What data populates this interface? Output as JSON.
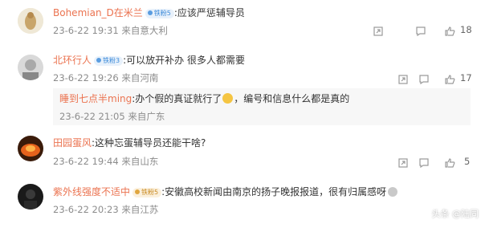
{
  "comments": [
    {
      "username": "Bohemian_D在米兰",
      "fan_badge": "铁粉5",
      "text": ":应该严惩辅导员",
      "time": "23-6-22 19:31",
      "location": "来自意大利",
      "likes": "18"
    },
    {
      "username": "北环行人",
      "fan_badge": "铁粉3",
      "text": ":可以放开补办  很多人都需要",
      "time": "23-6-22 19:26",
      "location": "来自河南",
      "likes": "17"
    },
    {
      "username": "睡到七点半ming",
      "text": ":办个假的真证就行了",
      "text2": "，编号和信息什么都是真的",
      "time": "23-6-22 21:05",
      "location": "来自广东"
    },
    {
      "username": "田园蛋风",
      "text": ":这种忘蛋辅导员还能干啥?",
      "time": "23-6-22 19:44",
      "location": "来自山东",
      "likes": "5"
    },
    {
      "username": "紫外线强度不适中",
      "fan_badge": "铁粉5",
      "text": ":安徽高校新闻由南京的扬子晚报报道，很有归属感呀",
      "time": "23-6-22 20:23",
      "location": "来自江苏"
    }
  ],
  "watermark": "头条 @陆同",
  "icons": [
    "share-icon",
    "comment-icon",
    "like-icon",
    "grin-emoji"
  ]
}
